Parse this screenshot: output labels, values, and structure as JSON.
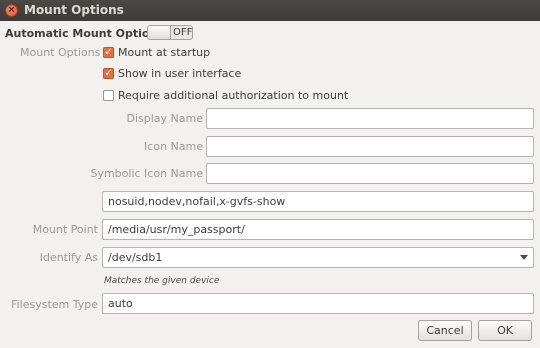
{
  "window": {
    "title": "Mount Options"
  },
  "automatic": {
    "label": "Automatic Mount Options",
    "toggle_state": "OFF"
  },
  "mount_options": {
    "label": "Mount Options",
    "checkboxes": [
      {
        "label": "Mount at startup",
        "checked": true
      },
      {
        "label": "Show in user interface",
        "checked": true
      },
      {
        "label": "Require additional authorization to mount",
        "checked": false
      }
    ]
  },
  "fields": {
    "display_name": {
      "label": "Display Name",
      "value": ""
    },
    "icon_name": {
      "label": "Icon Name",
      "value": ""
    },
    "symbolic_icon_name": {
      "label": "Symbolic Icon Name",
      "value": ""
    },
    "options_value": "nosuid,nodev,nofail,x-gvfs-show",
    "mount_point": {
      "label": "Mount Point",
      "value": "/media/usr/my_passport/"
    },
    "identify_as": {
      "label": "Identify As",
      "value": "/dev/sdb1",
      "hint": "Matches the given device"
    },
    "filesystem_type": {
      "label": "Filesystem Type",
      "value": "auto"
    }
  },
  "buttons": {
    "cancel": "Cancel",
    "ok": "OK"
  },
  "colors": {
    "accent": "#e9703a",
    "titlebar": "#3c3b37"
  }
}
